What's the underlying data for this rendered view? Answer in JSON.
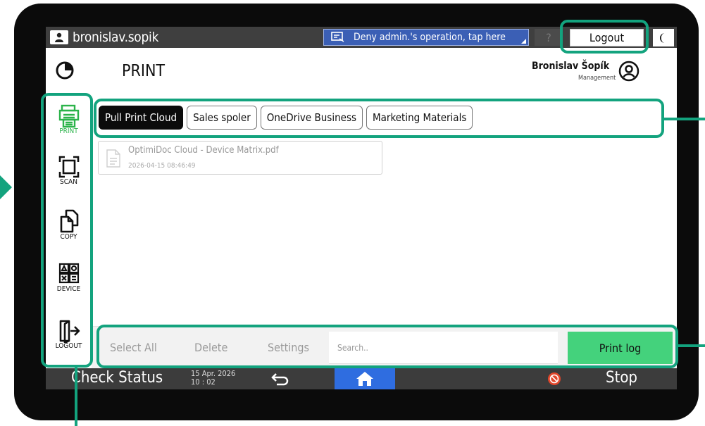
{
  "topbar": {
    "username": "bronislav.sopik",
    "deny_text": "Deny admin.'s operation, tap here",
    "help_label": "?",
    "logout_label": "Logout"
  },
  "header": {
    "title": "PRINT",
    "account_name": "Bronislav Šopík",
    "account_role": "Management"
  },
  "sidebar": {
    "items": [
      {
        "label": "PRINT",
        "icon": "printer-icon",
        "active": true
      },
      {
        "label": "SCAN",
        "icon": "scan-icon",
        "active": false
      },
      {
        "label": "COPY",
        "icon": "copy-icon",
        "active": false
      },
      {
        "label": "DEVICE",
        "icon": "device-icon",
        "active": false
      },
      {
        "label": "LOGOUT",
        "icon": "logout-icon",
        "active": false
      }
    ]
  },
  "tabs": [
    {
      "label": "Pull Print Cloud",
      "active": true
    },
    {
      "label": "Sales spoler",
      "active": false
    },
    {
      "label": "OneDrive Business",
      "active": false
    },
    {
      "label": "Marketing Materials",
      "active": false
    }
  ],
  "files": [
    {
      "name": "OptimiDoc Cloud - Device Matrix.pdf",
      "date": "2026-04-15 08:46:49"
    }
  ],
  "actions": {
    "select_all": "Select All",
    "delete": "Delete",
    "settings": "Settings",
    "search_placeholder": "Search..",
    "print_log": "Print log"
  },
  "statusbar": {
    "check_status": "Check Status",
    "date": "15 Apr. 2026",
    "time": "10 : 02",
    "stop_label": "Stop"
  },
  "colors": {
    "accent_green": "#13a37e",
    "print_log_bg": "#44d27c",
    "active_nav": "#2bb34a",
    "home_blue": "#2f6de0",
    "deny_blue": "#3b5fb5",
    "stop_red": "#e2462a"
  }
}
